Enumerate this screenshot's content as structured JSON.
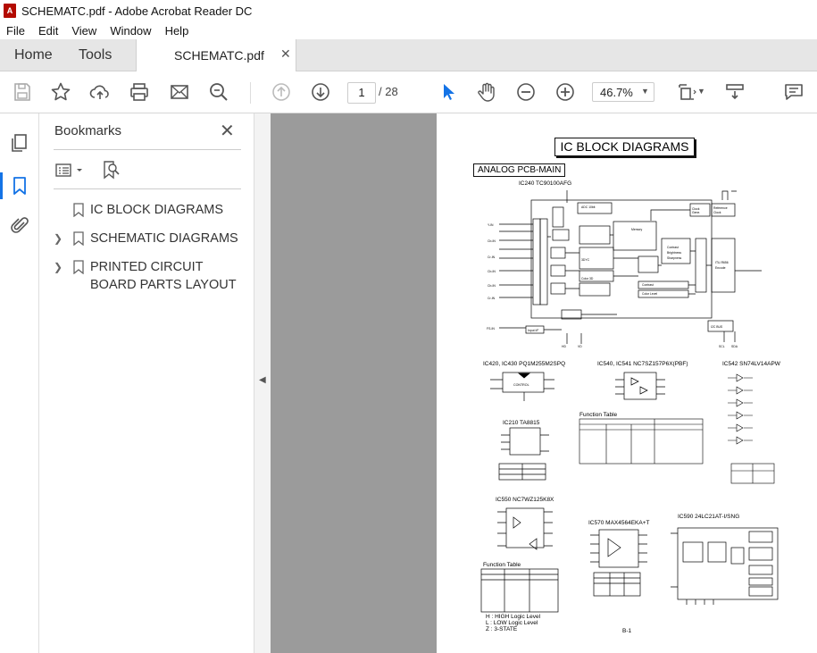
{
  "window": {
    "title": "SCHEMATC.pdf - Adobe Acrobat Reader DC",
    "app_icon_letter": "A"
  },
  "menu": [
    "File",
    "Edit",
    "View",
    "Window",
    "Help"
  ],
  "tabs": {
    "home": "Home",
    "tools": "Tools",
    "document": "SCHEMATC.pdf",
    "close_glyph": "✕"
  },
  "toolbar": {
    "page_current": "1",
    "page_total": "/ 28",
    "zoom": "46.7%"
  },
  "bookmarks": {
    "title": "Bookmarks",
    "close_glyph": "✕",
    "items": [
      {
        "label": "IC BLOCK DIAGRAMS",
        "expandable": false
      },
      {
        "label": "SCHEMATIC DIAGRAMS",
        "expandable": true
      },
      {
        "label": "PRINTED CIRCUIT BOARD PARTS LAYOUT",
        "expandable": true
      }
    ]
  },
  "document": {
    "heading": "IC BLOCK DIAGRAMS",
    "section": "ANALOG PCB-MAIN",
    "blocks": {
      "ic240": "IC240 TC90100AFG",
      "ic420": "IC420, IC430 PQ1M255M2SPQ",
      "ic540": "IC540, IC541 NC7SZ157P6X(PBF)",
      "ic542": "IC542 SN74LV14APW",
      "ic210": "IC210 TA8815",
      "ic550": "IC550 NC7WZ125K8X",
      "ic570": "IC570 MAX4564EKA+T",
      "ic590": "IC590 24LC21AT-I/SNG"
    },
    "labels": {
      "function_table": "Function Table",
      "inputs": "Inputs",
      "output": "Output",
      "control": "CONTROL",
      "itu_r": "ITU-R656 Encode",
      "memory": "Memory",
      "clock_gen": "Clock Gene.",
      "ref_clock": "Reference Clock",
      "i2c_bus": "I2C BUS",
      "input_if": "Input I/F",
      "legend_h": "H : HIGH Logic Level",
      "legend_l": "L : LOW Logic Level",
      "legend_z": "Z : 3-STATE"
    },
    "page_number": "B-1"
  },
  "colors": {
    "accent": "#1473e6",
    "doc_bg": "#9b9b9b",
    "tab_bg": "#e6e6e6"
  }
}
